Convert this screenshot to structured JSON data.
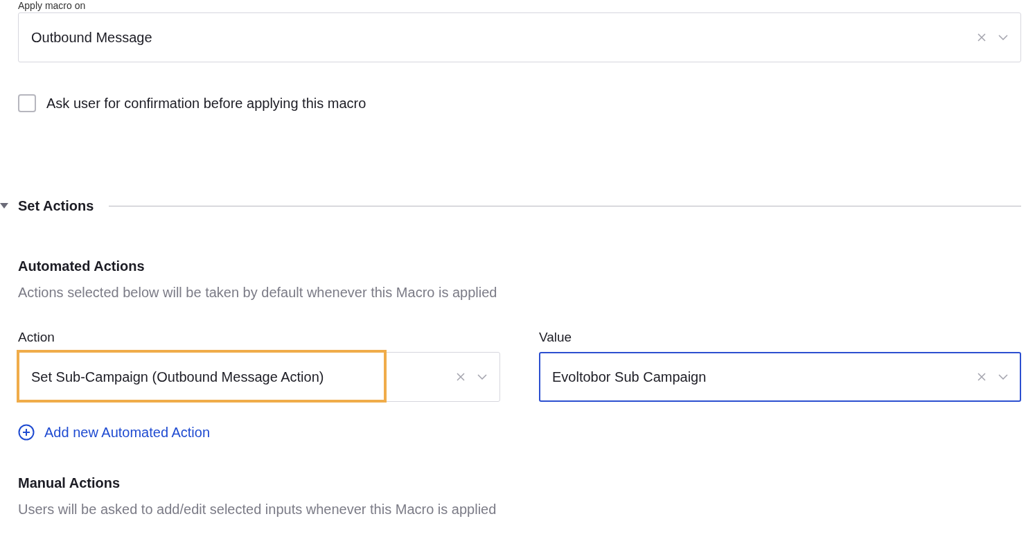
{
  "apply_macro_on": {
    "label": "Apply macro on",
    "value": "Outbound Message"
  },
  "confirmation": {
    "label": "Ask user for confirmation before applying this macro",
    "checked": false
  },
  "section": {
    "title": "Set Actions",
    "expanded": true
  },
  "automated_actions": {
    "title": "Automated Actions",
    "description": "Actions selected below will be taken by default whenever this Macro is applied",
    "rows": [
      {
        "action_label": "Action",
        "action": "Set Sub-Campaign (Outbound Message Action)",
        "action_highlighted": true,
        "value_label": "Value",
        "value": "Evoltobor Sub Campaign",
        "value_focused": true
      }
    ],
    "add_link": "Add new Automated Action"
  },
  "manual_actions": {
    "title": "Manual Actions",
    "description": "Users will be asked to add/edit selected inputs whenever this Macro is applied"
  }
}
